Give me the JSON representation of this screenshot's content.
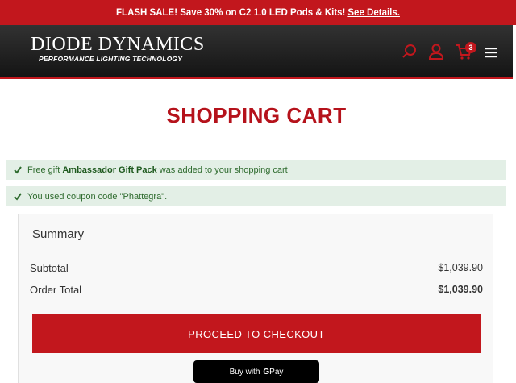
{
  "promo": {
    "text": "FLASH SALE! Save 30% on C2 1.0 LED Pods & Kits!",
    "link": "See Details."
  },
  "header": {
    "logo": "DIODE DYNAMICS",
    "tagline": "PERFORMANCE LIGHTING TECHNOLOGY",
    "cart_count": "3"
  },
  "page": {
    "title": "SHOPPING CART"
  },
  "messages": [
    {
      "prefix": "Free gift",
      "bold": "Ambassador Gift Pack",
      "suffix": "was added to your shopping cart"
    },
    {
      "text": "You used coupon code \"Phattegra\"."
    }
  ],
  "summary": {
    "title": "Summary",
    "subtotal_label": "Subtotal",
    "subtotal_value": "$1,039.90",
    "total_label": "Order Total",
    "total_value": "$1,039.90",
    "checkout_label": "PROCEED TO CHECKOUT",
    "gpay_label": "Buy with",
    "gpay_brand": "Pay"
  }
}
